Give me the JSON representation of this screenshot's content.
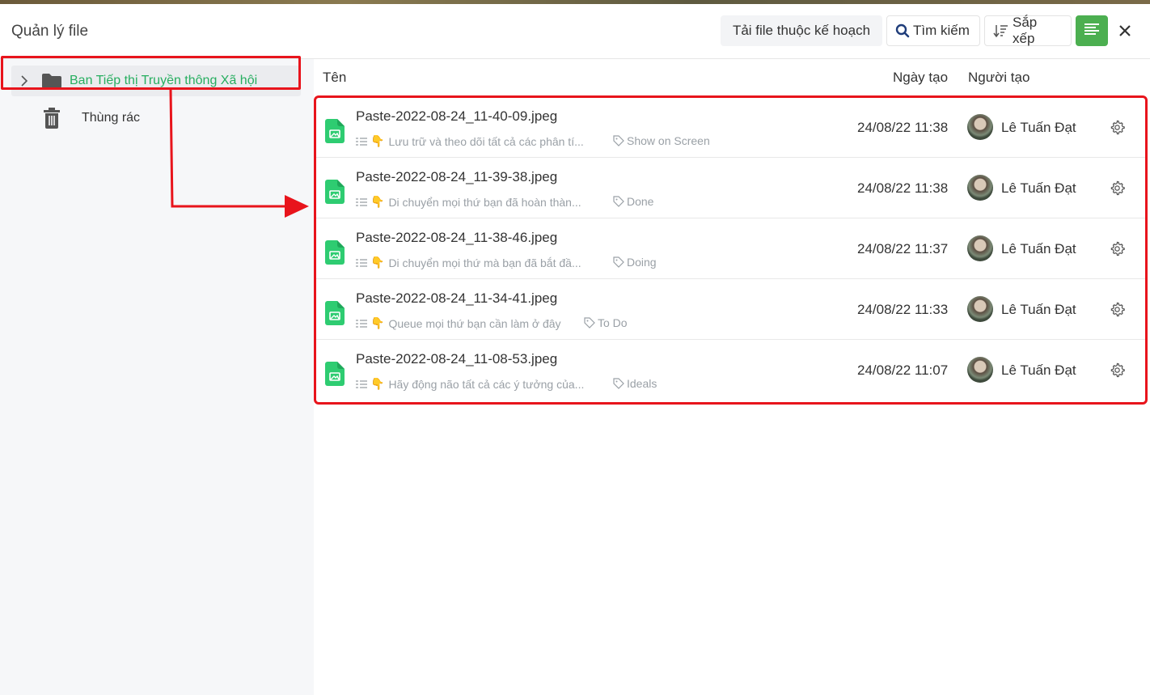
{
  "header": {
    "title": "Quản lý file",
    "upload_label": "Tải file thuộc kế hoạch",
    "search_label": "Tìm kiếm",
    "sort_label": "Sắp xếp"
  },
  "sidebar": {
    "folder_label": "Ban Tiếp thị Truyền thông Xã hội",
    "trash_label": "Thùng rác"
  },
  "columns": {
    "name": "Tên",
    "date": "Ngày tạo",
    "owner": "Người tạo"
  },
  "files": [
    {
      "name": "Paste-2022-08-24_11-40-09.jpeg",
      "desc": "Lưu trữ và theo dõi tất cả các phân tí...",
      "tag": "Show on Screen",
      "date": "24/08/22 11:38",
      "owner": "Lê Tuấn Đạt"
    },
    {
      "name": "Paste-2022-08-24_11-39-38.jpeg",
      "desc": "Di chuyển mọi thứ bạn đã hoàn thàn...",
      "tag": "Done",
      "date": "24/08/22 11:38",
      "owner": "Lê Tuấn Đạt"
    },
    {
      "name": "Paste-2022-08-24_11-38-46.jpeg",
      "desc": "Di chuyển mọi thứ mà bạn đã bắt đầ...",
      "tag": "Doing",
      "date": "24/08/22 11:37",
      "owner": "Lê Tuấn Đạt"
    },
    {
      "name": "Paste-2022-08-24_11-34-41.jpeg",
      "desc": "Queue mọi thứ bạn cần làm ở đây",
      "tag": "To Do",
      "date": "24/08/22 11:33",
      "owner": "Lê Tuấn Đạt"
    },
    {
      "name": "Paste-2022-08-24_11-08-53.jpeg",
      "desc": "Hãy động não tất cả các ý tưởng của...",
      "tag": "Ideals",
      "date": "24/08/22 11:07",
      "owner": "Lê Tuấn Đạt"
    }
  ],
  "colors": {
    "accent": "#4caf50",
    "folder_label": "#27ae60",
    "file_icon": "#2ecc71",
    "annotation": "#e8141c"
  },
  "icons": [
    "search-icon",
    "sort-icon",
    "menu-icon",
    "close-icon",
    "chevron-right-icon",
    "folder-icon",
    "trash-icon",
    "image-file-icon",
    "checklist-icon",
    "pointing-hand-icon",
    "tag-icon",
    "gear-icon",
    "avatar"
  ]
}
